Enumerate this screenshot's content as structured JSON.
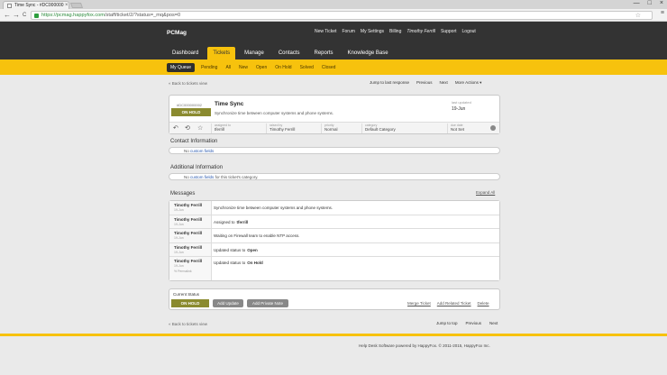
{
  "browser": {
    "tab_title": "Time Sync - #DC000000",
    "tab_close": "×",
    "window_controls": [
      "—",
      "□",
      "×"
    ],
    "back": "←",
    "forward": "→",
    "reload": "C",
    "url_host": "https://pcmag.happyfox.com",
    "url_path": "/staff/ticket/2/?status=_mq&pos=0",
    "star": "☆",
    "menu": "≡"
  },
  "header": {
    "brand": "PCMag",
    "top_links": [
      "New Ticket",
      "Forum",
      "My Settings",
      "Billing",
      "Timothy Ferrill",
      "Support",
      "Logout"
    ],
    "nav_tabs": [
      "Dashboard",
      "Tickets",
      "Manage",
      "Contacts",
      "Reports",
      "Knowledge Base"
    ],
    "active_tab": "Tickets"
  },
  "subnav": {
    "items": [
      "My Queue",
      "Pending",
      "All",
      "New",
      "Open",
      "On Hold",
      "Solved",
      "Closed"
    ],
    "active": "My Queue"
  },
  "top": {
    "back_link": "« Back to tickets view",
    "actions": [
      "Jump to last response",
      "Previous",
      "Next",
      "More Actions ▾"
    ]
  },
  "ticket": {
    "id": "#DC000000002",
    "status": "ON HOLD",
    "title": "Time Sync",
    "description": "Synchronize time between computer systems and phone systems.",
    "last_updated_label": "last updated",
    "last_updated_value": "19-Jun",
    "icons": [
      "↶",
      "⟲",
      "☆"
    ],
    "fields": [
      {
        "label": "assigned to",
        "value": "tferrill"
      },
      {
        "label": "raised by",
        "value": "Timothy Ferrill"
      },
      {
        "label": "priority",
        "value": "Normal"
      },
      {
        "label": "category",
        "value": "Default Category"
      },
      {
        "label": "due date",
        "value": "Not Set"
      }
    ]
  },
  "contact_info": {
    "title": "Contact Information",
    "prefix": "No",
    "link": "custom fields",
    "suffix": ""
  },
  "additional_info": {
    "title": "Additional Information",
    "prefix": "No",
    "link": "custom fields",
    "suffix": "for this ticket's category."
  },
  "messages": {
    "title": "Messages",
    "expand_all": "Expand All",
    "items": [
      {
        "author": "Timothy Ferrill",
        "date": "19-Jun",
        "text": "Synchronize time between computer systems and phone systems.",
        "bold": "",
        "perma": ""
      },
      {
        "author": "Timothy Ferrill",
        "date": "19-Jun",
        "text": "Assigned to",
        "bold": "tferrill",
        "perma": ""
      },
      {
        "author": "Timothy Ferrill",
        "date": "19-Jun",
        "text": "Waiting on Firewall team to enable NTP access.",
        "bold": "",
        "perma": ""
      },
      {
        "author": "Timothy Ferrill",
        "date": "19-Jun",
        "text": "Updated status to",
        "bold": "Open",
        "perma": ""
      },
      {
        "author": "Timothy Ferrill",
        "date": "19-Jun",
        "text": "Updated status to",
        "bold": "On Hold",
        "perma": "% Permalink"
      }
    ]
  },
  "status_card": {
    "label": "Current Status",
    "status": "ON HOLD",
    "add_update": "Add Update",
    "add_private_note": "Add Private Note",
    "links": [
      "Merge Ticket",
      "Add Related Ticket",
      "Delete"
    ]
  },
  "bottom": {
    "back_link": "« Back to tickets view",
    "actions": [
      "Jump to top",
      "Previous",
      "Next"
    ]
  },
  "footer": {
    "text": "Help Desk Software powered by HappyFox. © 2011-2015, HappyFox Inc."
  },
  "colors": {
    "accent": "#f7c20d",
    "header": "#333333",
    "status_on_hold": "#8a8a2f"
  }
}
